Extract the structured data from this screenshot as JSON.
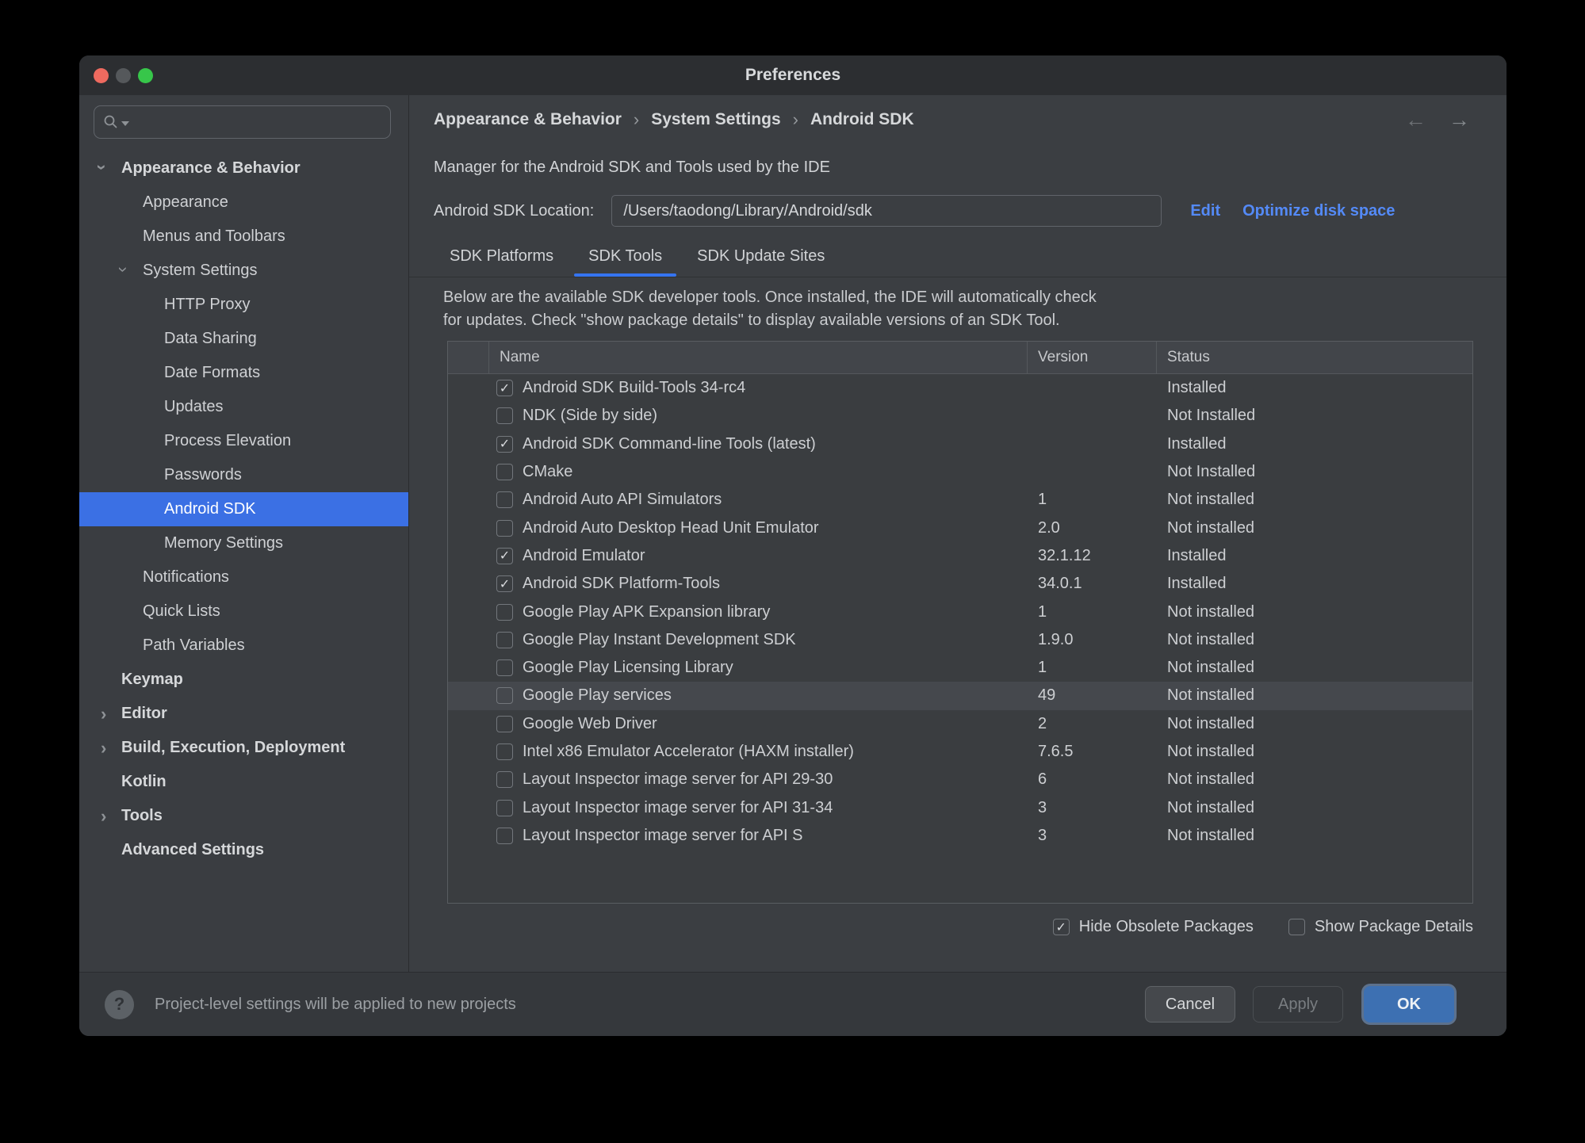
{
  "window": {
    "title": "Preferences"
  },
  "icons": {
    "search": "magnifier",
    "back_arrow": "←",
    "forward_arrow": "→",
    "breadcrumb_sep": "›",
    "help": "?",
    "check": "✓"
  },
  "sidebar": {
    "search_placeholder": "",
    "items": [
      {
        "label": "Appearance & Behavior",
        "level": 0,
        "bold": true,
        "arrow": "expanded"
      },
      {
        "label": "Appearance",
        "level": 1
      },
      {
        "label": "Menus and Toolbars",
        "level": 1
      },
      {
        "label": "System Settings",
        "level": 1,
        "arrow": "expanded"
      },
      {
        "label": "HTTP Proxy",
        "level": 2
      },
      {
        "label": "Data Sharing",
        "level": 2
      },
      {
        "label": "Date Formats",
        "level": 2
      },
      {
        "label": "Updates",
        "level": 2
      },
      {
        "label": "Process Elevation",
        "level": 2
      },
      {
        "label": "Passwords",
        "level": 2
      },
      {
        "label": "Android SDK",
        "level": 2,
        "selected": true
      },
      {
        "label": "Memory Settings",
        "level": 2
      },
      {
        "label": "Notifications",
        "level": 1
      },
      {
        "label": "Quick Lists",
        "level": 1
      },
      {
        "label": "Path Variables",
        "level": 1
      },
      {
        "label": "Keymap",
        "level": 0,
        "bold": true
      },
      {
        "label": "Editor",
        "level": 0,
        "bold": true,
        "arrow": "collapsed"
      },
      {
        "label": "Build, Execution, Deployment",
        "level": 0,
        "bold": true,
        "arrow": "collapsed"
      },
      {
        "label": "Kotlin",
        "level": 0,
        "bold": true
      },
      {
        "label": "Tools",
        "level": 0,
        "bold": true,
        "arrow": "collapsed"
      },
      {
        "label": "Advanced Settings",
        "level": 0,
        "bold": true
      }
    ]
  },
  "header": {
    "breadcrumb": [
      "Appearance & Behavior",
      "System Settings",
      "Android SDK"
    ],
    "manager_line": "Manager for the Android SDK and Tools used by the IDE",
    "location_label": "Android SDK Location:",
    "location_value": "/Users/taodong/Library/Android/sdk",
    "edit_link": "Edit",
    "optimize_link": "Optimize disk space"
  },
  "tabs": [
    {
      "label": "SDK Platforms",
      "active": false
    },
    {
      "label": "SDK Tools",
      "active": true
    },
    {
      "label": "SDK Update Sites",
      "active": false
    }
  ],
  "note": {
    "line1": "Below are the available SDK developer tools. Once installed, the IDE will automatically check",
    "line2": "for updates. Check \"show package details\" to display available versions of an SDK Tool."
  },
  "table": {
    "columns": [
      "Name",
      "Version",
      "Status"
    ],
    "rows": [
      {
        "checked": true,
        "name": "Android SDK Build-Tools 34-rc4",
        "version": "",
        "status": "Installed"
      },
      {
        "checked": false,
        "name": "NDK (Side by side)",
        "version": "",
        "status": "Not Installed"
      },
      {
        "checked": true,
        "name": "Android SDK Command-line Tools (latest)",
        "version": "",
        "status": "Installed"
      },
      {
        "checked": false,
        "name": "CMake",
        "version": "",
        "status": "Not Installed"
      },
      {
        "checked": false,
        "name": "Android Auto API Simulators",
        "version": "1",
        "status": "Not installed"
      },
      {
        "checked": false,
        "name": "Android Auto Desktop Head Unit Emulator",
        "version": "2.0",
        "status": "Not installed"
      },
      {
        "checked": true,
        "name": "Android Emulator",
        "version": "32.1.12",
        "status": "Installed"
      },
      {
        "checked": true,
        "name": "Android SDK Platform-Tools",
        "version": "34.0.1",
        "status": "Installed"
      },
      {
        "checked": false,
        "name": "Google Play APK Expansion library",
        "version": "1",
        "status": "Not installed"
      },
      {
        "checked": false,
        "name": "Google Play Instant Development SDK",
        "version": "1.9.0",
        "status": "Not installed"
      },
      {
        "checked": false,
        "name": "Google Play Licensing Library",
        "version": "1",
        "status": "Not installed"
      },
      {
        "checked": false,
        "name": "Google Play services",
        "version": "49",
        "status": "Not installed",
        "highlighted": true
      },
      {
        "checked": false,
        "name": "Google Web Driver",
        "version": "2",
        "status": "Not installed"
      },
      {
        "checked": false,
        "name": "Intel x86 Emulator Accelerator (HAXM installer)",
        "version": "7.6.5",
        "status": "Not installed"
      },
      {
        "checked": false,
        "name": "Layout Inspector image server for API 29-30",
        "version": "6",
        "status": "Not installed"
      },
      {
        "checked": false,
        "name": "Layout Inspector image server for API 31-34",
        "version": "3",
        "status": "Not installed"
      },
      {
        "checked": false,
        "name": "Layout Inspector image server for API S",
        "version": "3",
        "status": "Not installed"
      }
    ]
  },
  "options": {
    "hide_obsolete": {
      "label": "Hide Obsolete Packages",
      "checked": true
    },
    "show_details": {
      "label": "Show Package Details",
      "checked": false
    }
  },
  "footer": {
    "note": "Project-level settings will be applied to new projects",
    "cancel_label": "Cancel",
    "apply_label": "Apply",
    "ok_label": "OK"
  },
  "colors": {
    "selection_blue": "#3B70E4",
    "tab_underline_blue": "#3574F0",
    "link_blue": "#548AF7",
    "ok_button_blue": "#3D70B2",
    "traffic_red": "#EE6A5F",
    "traffic_green": "#37C64A"
  }
}
